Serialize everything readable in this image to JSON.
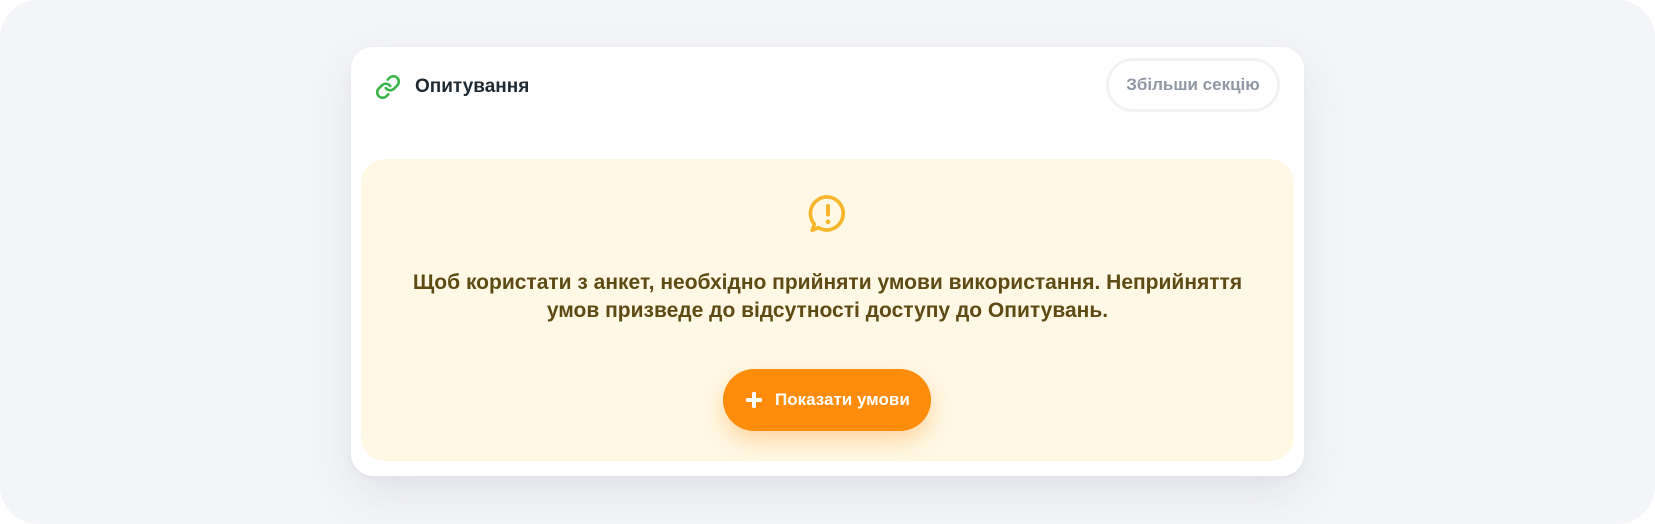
{
  "card": {
    "title": "Опитування",
    "title_icon": "link-icon",
    "expand_button_label": "Збільши секцію"
  },
  "notice": {
    "icon": "alert-message-icon",
    "message": "Щоб користати з анкет, необхідно прийняти умови використання. Неприйняття умов призведе до відсутності доступу до Опитувань.",
    "button_icon": "plus-icon",
    "button_label": "Показати умови"
  },
  "colors": {
    "backdrop": "#f4f5f8",
    "card_background": "#ffffff",
    "notice_background": "#fff8e5",
    "notice_text": "#5e4a14",
    "accent_orange": "#ff8c0a",
    "warning_icon": "#f7b52c",
    "link_icon": "#3bb54a",
    "muted_button_text": "#9098a3"
  }
}
